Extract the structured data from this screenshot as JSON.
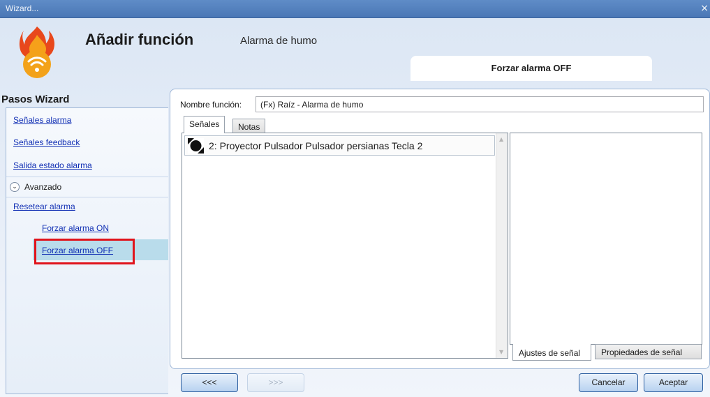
{
  "window": {
    "title": "Wizard...",
    "close_glyph": "×"
  },
  "header": {
    "title": "Añadir función",
    "subtitle": "Alarma de humo",
    "current_step_tab": "Forzar alarma OFF",
    "logo_icon": "flame-wifi-icon"
  },
  "steps": {
    "title": "Pasos Wizard",
    "items": [
      {
        "label": "Señales alarma"
      },
      {
        "label": "Señales feedback"
      },
      {
        "label": "Salida estado alarma"
      }
    ],
    "advanced_label": "Avanzado",
    "advanced_items": [
      {
        "label": "Resetear alarma"
      },
      {
        "label": "Forzar alarma ON"
      },
      {
        "label": "Forzar alarma OFF",
        "selected": true
      }
    ]
  },
  "form": {
    "name_label": "Nombre función:",
    "name_value": "(Fx) Raíz - Alarma de humo"
  },
  "tabs": [
    {
      "label": "Señales",
      "active": true
    },
    {
      "label": "Notas",
      "active": false
    }
  ],
  "signals": [
    {
      "label": "2: Proyector Pulsador Pulsador persianas Tecla 2",
      "icon": "signal-dot-icon"
    }
  ],
  "bottom_tabs": [
    {
      "label": "Ajustes de señal",
      "active": true
    },
    {
      "label": "Propiedades de señal",
      "active": false
    }
  ],
  "buttons": {
    "prev": "<<<",
    "next": ">>>",
    "cancel": "Cancelar",
    "ok": "Aceptar"
  },
  "colors": {
    "title_bar": "#4a77b5",
    "link": "#1230b4",
    "selected_row": "#b9dceb",
    "highlight_box": "#e0131b"
  }
}
